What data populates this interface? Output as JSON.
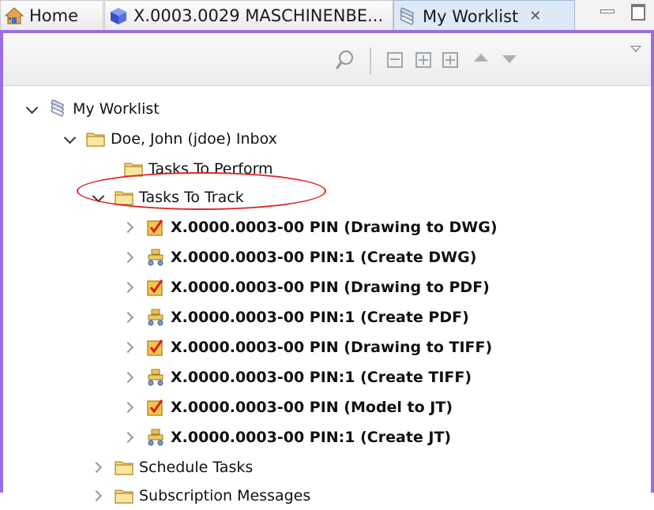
{
  "tabs": [
    {
      "label": "Home",
      "icon": "home-icon"
    },
    {
      "label": "X.0003.0029 MASCHINENBE...",
      "icon": "item-cube-icon"
    },
    {
      "label": "My Worklist",
      "icon": "worklist-icon",
      "active": true,
      "close_glyph": "✕"
    }
  ],
  "colors": {
    "view_border": "#9b6ee0",
    "highlight": "#e02525",
    "folder": "#e8c45a"
  },
  "tree": {
    "root": {
      "label": "My Worklist",
      "icon": "worklist-icon",
      "expanded": true
    },
    "inbox": {
      "label": "Doe, John (jdoe) Inbox",
      "icon": "folder-icon",
      "expanded": true
    },
    "tasks_to_perform": {
      "label": "Tasks To Perform",
      "icon": "folder-icon"
    },
    "tasks_to_track": {
      "label": "Tasks To Track",
      "icon": "folder-icon",
      "expanded": true
    },
    "tasks": [
      {
        "label": "X.0000.0003-00 PIN (Drawing to DWG)",
        "icon": "checkmark-task-icon"
      },
      {
        "label": "X.0000.0003-00 PIN:1 (Create DWG)",
        "icon": "workflow-task-icon"
      },
      {
        "label": "X.0000.0003-00 PIN (Drawing to PDF)",
        "icon": "checkmark-task-icon"
      },
      {
        "label": "X.0000.0003-00 PIN:1 (Create PDF)",
        "icon": "workflow-task-icon"
      },
      {
        "label": "X.0000.0003-00 PIN (Drawing to TIFF)",
        "icon": "checkmark-task-icon"
      },
      {
        "label": "X.0000.0003-00 PIN:1 (Create TIFF)",
        "icon": "workflow-task-icon"
      },
      {
        "label": "X.0000.0003-00 PIN (Model to JT)",
        "icon": "checkmark-task-icon"
      },
      {
        "label": "X.0000.0003-00 PIN:1 (Create JT)",
        "icon": "workflow-task-icon"
      }
    ],
    "schedule_tasks": {
      "label": "Schedule Tasks",
      "icon": "folder-icon"
    },
    "subscription_messages": {
      "label": "Subscription Messages",
      "icon": "folder-icon"
    }
  }
}
